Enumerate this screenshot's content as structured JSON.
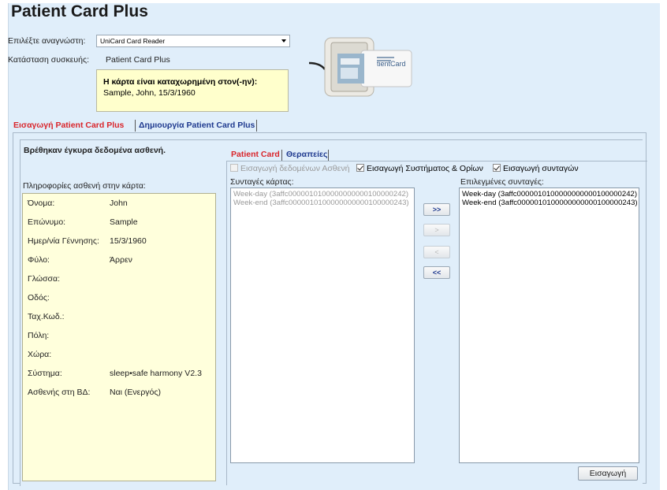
{
  "app": {
    "title": "Patient Card Plus"
  },
  "reader_section": {
    "select_label": "Επιλέξτε αναγνώστη:",
    "select_value": "UniCard Card Reader",
    "device_status_label": "Κατάσταση συσκευής:",
    "device_status_value": "Patient Card Plus",
    "note_title": "Η κάρτα είναι καταχωρημένη στον(-ην):",
    "note_value": "Sample, John, 15/3/1960"
  },
  "main_tabs": [
    {
      "label": "Εισαγωγή Patient Card Plus",
      "active": true
    },
    {
      "label": "Δημιουργία Patient Card Plus",
      "active": false
    }
  ],
  "patient": {
    "found_message": "Βρέθηκαν έγκυρα δεδομένα ασθενή.",
    "info_label": "Πληροφορίες ασθενή στην κάρτα:",
    "fields": [
      {
        "label": "Όνομα:",
        "value": "John"
      },
      {
        "label": "Επώνυμο:",
        "value": "Sample"
      },
      {
        "label": "Ημερ/νία Γέννησης:",
        "value": "15/3/1960"
      },
      {
        "label": "Φύλο:",
        "value": "Άρρεν"
      },
      {
        "label": "Γλώσσα:",
        "value": ""
      },
      {
        "label": "Οδός:",
        "value": ""
      },
      {
        "label": "Ταχ.Κωδ.:",
        "value": ""
      },
      {
        "label": "Πόλη:",
        "value": ""
      },
      {
        "label": "Χώρα:",
        "value": ""
      },
      {
        "label": "Σύστημα:",
        "value": "sleep•safe harmony V2.3"
      },
      {
        "label": "Ασθενής στη ΒΔ:",
        "value": "Ναι (Ενεργός)"
      }
    ]
  },
  "sub_tabs": [
    {
      "label": "Patient Card",
      "active": true
    },
    {
      "label": "Θεραπείες",
      "active": false
    }
  ],
  "options": {
    "import_patient_data": {
      "label": "Εισαγωγή δεδομένων Ασθενή",
      "checked": false,
      "disabled": true
    },
    "import_system_limits": {
      "label": "Εισαγωγή Συστήματος & Ορίων",
      "checked": true,
      "disabled": false
    },
    "import_prescriptions": {
      "label": "Εισαγωγή συνταγών",
      "checked": true,
      "disabled": false
    }
  },
  "card_prescriptions": {
    "label": "Συνταγές κάρτας:",
    "items": [
      "Week-day (3affc0000010100000000000100000242)",
      "Week-end (3affc0000010100000000000100000243)"
    ]
  },
  "selected_prescriptions": {
    "label": "Επιλεγμένες συνταγές:",
    "items": [
      "Week-day (3affc0000010100000000000100000242)",
      "Week-end (3affc0000010100000000000100000243)"
    ]
  },
  "move_buttons": {
    "add_all": ">>",
    "add_one": ">",
    "remove_one": "<",
    "remove_all": "<<"
  },
  "import_button": "Εισαγωγή",
  "colors": {
    "background": "#e0eefa",
    "active_tab": "#d9252b",
    "inactive_tab": "#1f3a8f",
    "note_background": "#ffffcc"
  }
}
